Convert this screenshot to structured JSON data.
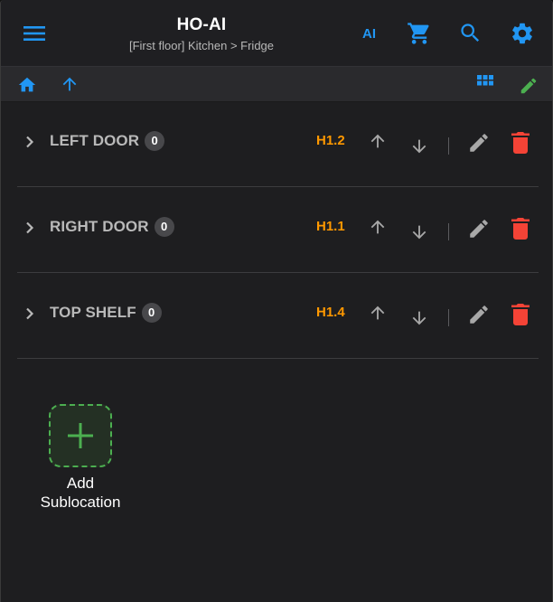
{
  "header": {
    "title": "HO-AI",
    "subtitle": "[First floor] Kitchen > Fridge",
    "ai_label": "AI",
    "icons": [
      "menu-icon",
      "cart-icon",
      "search-icon",
      "gear-icon"
    ]
  },
  "toolbar": {
    "icons": [
      "home-icon",
      "arrow-up-icon",
      "grid-icon",
      "pencil-icon"
    ]
  },
  "rows": [
    {
      "name": "LEFT DOOR",
      "count": "0",
      "code": "H1.2"
    },
    {
      "name": "RIGHT DOOR",
      "count": "0",
      "code": "H1.1"
    },
    {
      "name": "TOP SHELF",
      "count": "0",
      "code": "H1.4"
    }
  ],
  "add_sublocation": {
    "label_line1": "Add",
    "label_line2": "Sublocation"
  },
  "colors": {
    "accent_blue": "#2196f3",
    "code_orange": "#ff9800",
    "edit_green": "#4caf50",
    "delete_red": "#f44336",
    "background": "#1e1e20"
  }
}
